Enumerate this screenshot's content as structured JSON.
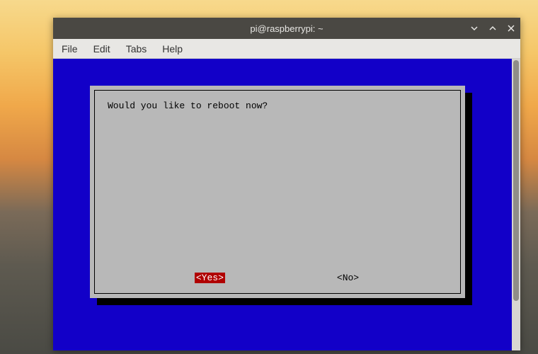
{
  "titlebar": {
    "title": "pi@raspberrypi: ~"
  },
  "menubar": {
    "file": "File",
    "edit": "Edit",
    "tabs": "Tabs",
    "help": "Help"
  },
  "dialog": {
    "prompt": "Would you like to reboot now?",
    "yes_label": "<Yes>",
    "no_label": "<No>"
  },
  "colors": {
    "terminal_bg": "#1200c8",
    "dialog_bg": "#b8b8b8",
    "selected_bg": "#b00000"
  }
}
